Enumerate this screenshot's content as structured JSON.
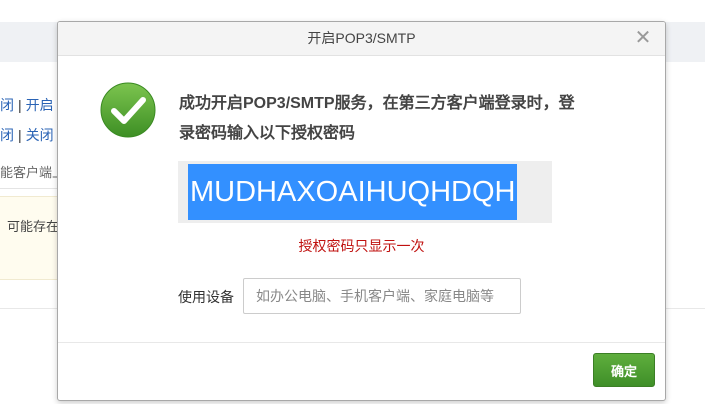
{
  "background": {
    "row1": {
      "link1": "闭",
      "sep": "|",
      "link2": "开启"
    },
    "row2": {
      "link1": "闭",
      "sep": "|",
      "link2": "关闭"
    },
    "note": "能客户端上",
    "warning": "可能存在"
  },
  "dialog": {
    "title": "开启POP3/SMTP",
    "close_glyph": "✕",
    "message": "成功开启POP3/SMTP服务，在第三方客户端登录时，登录密码输入以下授权密码",
    "auth_code": "MUDHAXOAIHUQHDQH",
    "code_note": "授权密码只显示一次",
    "device_label": "使用设备",
    "device_placeholder": "如办公电脑、手机客户端、家庭电脑等",
    "device_value": "",
    "confirm_label": "确定",
    "icon": "check-circle-icon",
    "accent_color": "#4e9d33",
    "selection_color": "#3390ff"
  }
}
